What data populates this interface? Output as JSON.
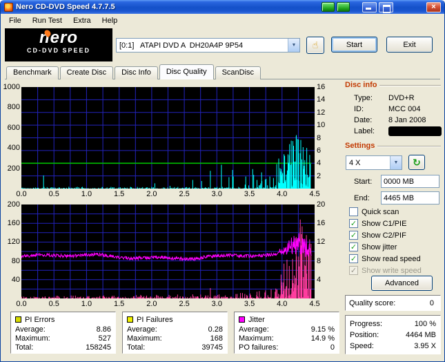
{
  "window": {
    "title": "Nero CD-DVD Speed 4.7.7.5"
  },
  "icons": {
    "close": "×",
    "dropdown_arrow": "▼",
    "hand": "☝",
    "refresh": "↻",
    "check": "✓"
  },
  "menu": {
    "items": [
      "File",
      "Run Test",
      "Extra",
      "Help"
    ]
  },
  "header": {
    "logo_line1": "nero",
    "logo_line2": "CD-DVD SPEED",
    "drive": "[0:1]   ATAPI DVD A  DH20A4P 9P54",
    "start": "Start",
    "exit": "Exit"
  },
  "tabs": {
    "items": [
      "Benchmark",
      "Create Disc",
      "Disc Info",
      "Disc Quality",
      "ScanDisc"
    ],
    "active_index": 3
  },
  "disc_info": {
    "title": "Disc info",
    "rows": [
      {
        "label": "Type:",
        "value": "DVD+R"
      },
      {
        "label": "ID:",
        "value": "MCC 004"
      },
      {
        "label": "Date:",
        "value": "8 Jan 2008"
      },
      {
        "label": "Label:",
        "value": "",
        "redacted": true
      }
    ]
  },
  "settings": {
    "title": "Settings",
    "speed": "4 X",
    "start_label": "Start:",
    "start_value": "0000 MB",
    "end_label": "End:",
    "end_value": "4465 MB",
    "checkboxes": [
      {
        "label": "Quick scan",
        "checked": false,
        "enabled": true
      },
      {
        "label": "Show C1/PIE",
        "checked": true,
        "enabled": true
      },
      {
        "label": "Show C2/PIF",
        "checked": true,
        "enabled": true
      },
      {
        "label": "Show jitter",
        "checked": true,
        "enabled": true
      },
      {
        "label": "Show read speed",
        "checked": true,
        "enabled": true
      },
      {
        "label": "Show write speed",
        "checked": true,
        "enabled": false
      }
    ],
    "advanced": "Advanced"
  },
  "quality": {
    "label": "Quality score:",
    "value": "0"
  },
  "progress": {
    "rows": [
      {
        "label": "Progress:",
        "value": "100 %"
      },
      {
        "label": "Position:",
        "value": "4464 MB"
      },
      {
        "label": "Speed:",
        "value": "3.95 X"
      }
    ]
  },
  "stats": [
    {
      "title": "PI Errors",
      "swatch": "#d8dc00",
      "rows": [
        {
          "label": "Average:",
          "value": "8.86"
        },
        {
          "label": "Maximum:",
          "value": "527"
        },
        {
          "label": "Total:",
          "value": "158245"
        }
      ]
    },
    {
      "title": "PI Failures",
      "swatch": "#f0f000",
      "rows": [
        {
          "label": "Average:",
          "value": "0.28"
        },
        {
          "label": "Maximum:",
          "value": "168"
        },
        {
          "label": "Total:",
          "value": "39745"
        }
      ]
    },
    {
      "title": "Jitter",
      "swatch": "#ff00ff",
      "rows": [
        {
          "label": "Average:",
          "value": "9.15 %"
        },
        {
          "label": "Maximum:",
          "value": "14.9 %"
        },
        {
          "label": "PO failures:",
          "value": "0"
        }
      ]
    }
  ],
  "chart_data": {
    "type": "line",
    "grid_color": "#2323bd",
    "x_max": 4.5,
    "x_ticks": [
      "0.0",
      "0.5",
      "1.0",
      "1.5",
      "2.0",
      "2.5",
      "3.0",
      "3.5",
      "4.0",
      "4.5"
    ],
    "top": {
      "height": 147,
      "h_divisions": 8,
      "v_step": 0.25,
      "left_max": 1000,
      "right_max": 16,
      "left_ticks": [
        "1000",
        "800",
        "600",
        "400",
        "200"
      ],
      "right_ticks": [
        "16",
        "14",
        "12",
        "10",
        "8",
        "6",
        "4",
        "2"
      ],
      "series": [
        {
          "name": "read-speed",
          "type": "hline",
          "value": 4,
          "x_end": 4.45,
          "color": "#00c000"
        },
        {
          "name": "c1-pie",
          "type": "spikes",
          "color": "#00ffff",
          "scale_max": 1000,
          "seed": 20080108,
          "samples": 880,
          "x_end": 4.45,
          "base": 18,
          "pow": 1.9,
          "density": [
            [
              0,
              0.006
            ],
            [
              2.6,
              0.01
            ],
            [
              2.95,
              0.05
            ],
            [
              3.3,
              0.13
            ],
            [
              3.6,
              0.22
            ],
            [
              3.95,
              0.45
            ],
            [
              4.05,
              0.85
            ],
            [
              4.45,
              0.85
            ]
          ],
          "amplitude": [
            [
              0,
              70
            ],
            [
              2.6,
              110
            ],
            [
              3.0,
              190
            ],
            [
              3.5,
              210
            ],
            [
              3.9,
              270
            ],
            [
              4.05,
              430
            ],
            [
              4.2,
              527
            ],
            [
              4.35,
              500
            ],
            [
              4.45,
              380
            ]
          ],
          "extra": [
            [
              0.34,
              130
            ],
            [
              2.63,
              85
            ],
            [
              2.9,
              175
            ],
            [
              3.07,
              235
            ],
            [
              4.22,
              527
            ]
          ],
          "average": 8.86,
          "maximum": 527,
          "total": 158245
        }
      ]
    },
    "bottom": {
      "height": 136,
      "h_divisions": 10,
      "v_step": 0.25,
      "left_max": 200,
      "right_max": 20,
      "left_ticks": [
        "200",
        "160",
        "120",
        "80",
        "40"
      ],
      "right_ticks": [
        "20",
        "16",
        "12",
        "8",
        "4"
      ],
      "series": [
        {
          "name": "c2-pif",
          "type": "spikes",
          "color": "#ff3d9e",
          "scale_max": 200,
          "seed": 41108,
          "samples": 880,
          "x_end": 4.45,
          "base": 4,
          "pow": 2.0,
          "density": [
            [
              0,
              0.3
            ],
            [
              3.0,
              0.3
            ],
            [
              3.5,
              0.35
            ],
            [
              3.95,
              0.4
            ],
            [
              4.02,
              0.8
            ],
            [
              4.45,
              0.8
            ]
          ],
          "amplitude": [
            [
              0,
              6
            ],
            [
              3.0,
              9
            ],
            [
              3.5,
              14
            ],
            [
              3.95,
              24
            ],
            [
              4.05,
              110
            ],
            [
              4.25,
              168
            ],
            [
              4.45,
              130
            ]
          ],
          "extra": [
            [
              2.9,
              22
            ],
            [
              4.28,
              168
            ]
          ],
          "average": 0.28,
          "maximum": 168,
          "total": 39745
        },
        {
          "name": "jitter",
          "type": "noisy-line",
          "color": "#ff00ff",
          "seed": 915,
          "samples": 700,
          "x_end": 4.45,
          "base": 8.9,
          "wave1": 0.35,
          "wf1": 2.1,
          "wave2": 0.2,
          "wf2": 6.7,
          "noise": 0.7,
          "clamp": 14.9,
          "extra_env": [
            [
              0,
              0
            ],
            [
              3.9,
              0
            ],
            [
              4.05,
              2.0
            ],
            [
              4.15,
              4.0
            ],
            [
              4.3,
              5.2
            ],
            [
              4.4,
              4.0
            ],
            [
              4.45,
              2.5
            ]
          ],
          "average": 9.15,
          "maximum": 14.9
        }
      ]
    }
  }
}
